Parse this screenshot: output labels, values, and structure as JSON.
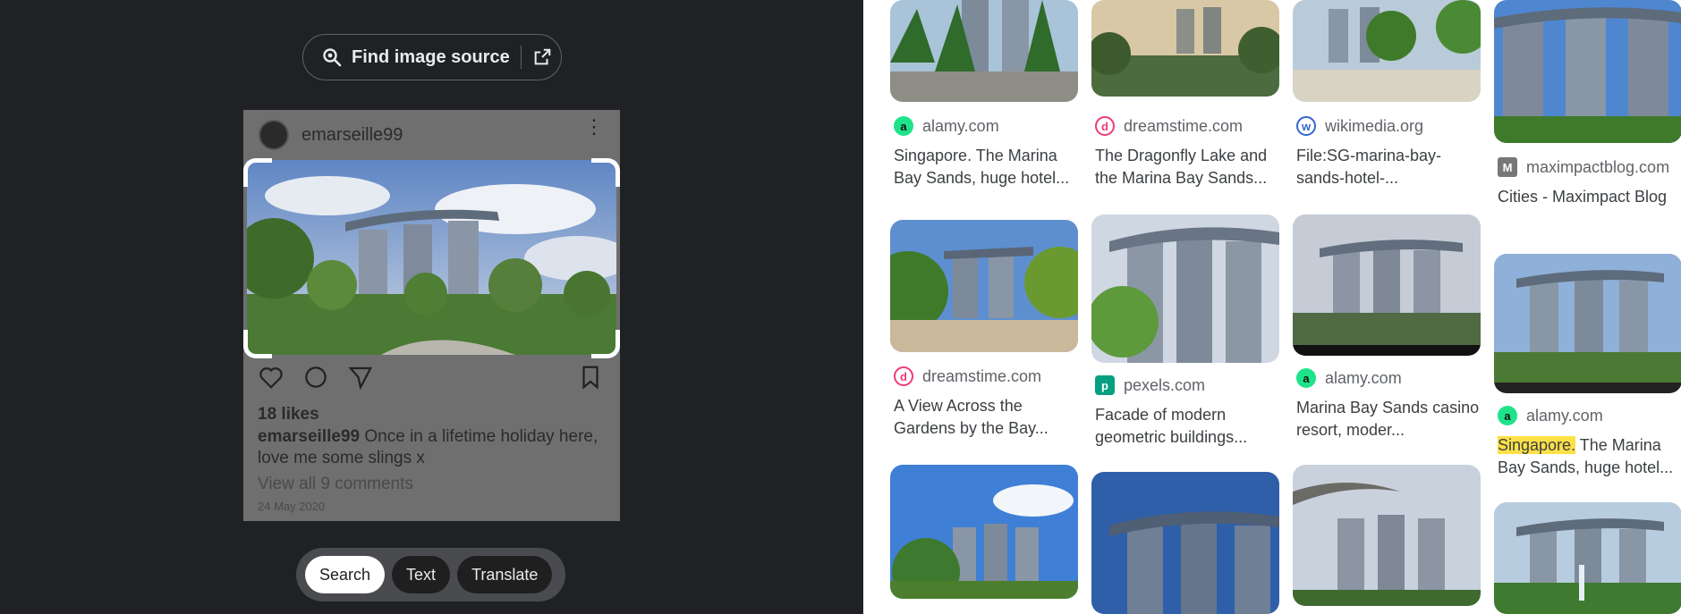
{
  "lens_panel": {
    "find_source_label": "Find image source",
    "post": {
      "username": "emarseille99",
      "likes": "18 likes",
      "caption_user": "emarseille99",
      "caption_text": "Once in a lifetime holiday here, love me some slings x",
      "view_comments": "View all 9 comments",
      "date": "24 May 2020"
    },
    "modes": [
      "Search",
      "Text",
      "Translate"
    ],
    "active_mode": "Search"
  },
  "results": [
    {
      "site": "alamy.com",
      "title": "Singapore. The Marina Bay Sands, huge hotel...",
      "favicon": "alamy-icon",
      "fav_color": "#1ee38a"
    },
    {
      "site": "dreamstime.com",
      "title": "The Dragonfly Lake and the Marina Bay Sands...",
      "favicon": "dreamstime-icon",
      "fav_color": "#ef3a7a"
    },
    {
      "site": "wikimedia.org",
      "title": "File:SG-marina-bay-sands-hotel-...",
      "favicon": "wikimedia-icon",
      "fav_color": "#3366cc"
    },
    {
      "site": "maximpactblog.com",
      "title": "Cities - Maximpact Blog",
      "favicon": "maximpact-icon",
      "fav_color": "#777777"
    },
    {
      "site": "dreamstime.com",
      "title": "A View Across the Gardens by the Bay...",
      "favicon": "dreamstime-icon",
      "fav_color": "#ef3a7a"
    },
    {
      "site": "pexels.com",
      "title": "Facade of modern geometric buildings...",
      "favicon": "pexels-icon",
      "fav_color": "#05a081"
    },
    {
      "site": "alamy.com",
      "title": "Marina Bay Sands casino resort, moder...",
      "favicon": "alamy-icon",
      "fav_color": "#1ee38a"
    },
    {
      "site": "alamy.com",
      "title_highlight": "Singapore.",
      "title_rest": " The Marina Bay Sands, huge hotel...",
      "favicon": "alamy-icon",
      "fav_color": "#1ee38a"
    }
  ]
}
